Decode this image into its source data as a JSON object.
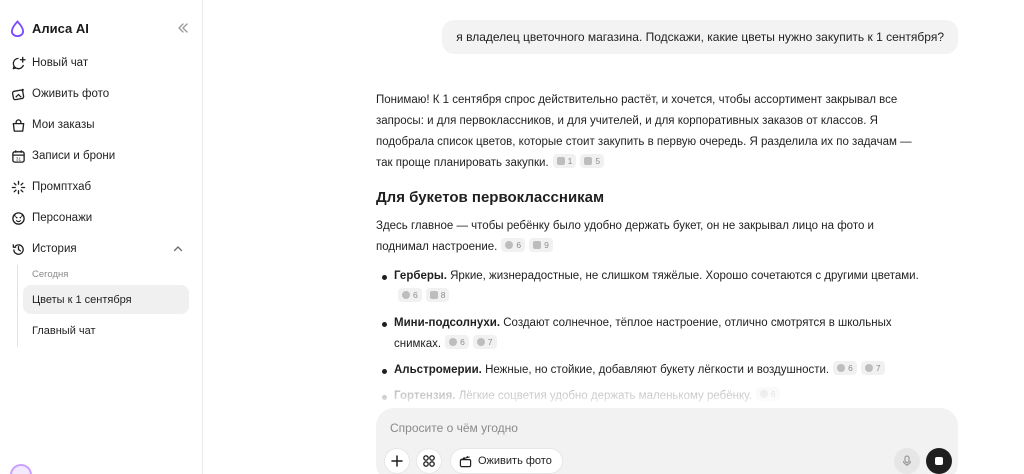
{
  "app": {
    "name": "Алиса AI",
    "brand_color": "#7b4dff"
  },
  "sidebar": {
    "nav": [
      {
        "label": "Новый чат",
        "icon": "new-chat-icon"
      },
      {
        "label": "Оживить фото",
        "icon": "animate-photo-icon"
      },
      {
        "label": "Мои заказы",
        "icon": "shopping-bag-icon"
      },
      {
        "label": "Записи и брони",
        "icon": "calendar-icon"
      },
      {
        "label": "Промптхаб",
        "icon": "sparkle-icon"
      },
      {
        "label": "Персонажи",
        "icon": "characters-icon"
      },
      {
        "label": "История",
        "icon": "history-icon"
      }
    ],
    "history_section": "Сегодня",
    "history": [
      {
        "label": "Цветы к 1 сентября",
        "active": true
      },
      {
        "label": "Главный чат",
        "active": false
      }
    ]
  },
  "chat": {
    "user_message": "я владелец цветочного магазина. Подскажи, какие цветы нужно закупить к 1 сентября?",
    "intro": "Понимаю! К 1 сентября спрос действительно растёт, и хочется, чтобы ассортимент закрывал все запросы: и для первоклассников, и для учителей, и для корпоративных заказов от классов. Я подобрала список цветов, которые стоит закупить в первую очередь. Я разделила их по задачам — так проще планировать закупки.",
    "intro_sources": [
      "1",
      "5"
    ],
    "heading": "Для букетов первоклассникам",
    "para": "Здесь главное — чтобы ребёнку было удобно держать букет, он не закрывал лицо на фото и поднимал настроение.",
    "para_sources": [
      "6",
      "9"
    ],
    "items": [
      {
        "title": "Герберы.",
        "text": "Яркие, жизнерадостные, не слишком тяжёлые. Хорошо сочетаются с другими цветами.",
        "sources": [
          "6",
          "8"
        ]
      },
      {
        "title": "Мини-подсолнухи.",
        "text": "Создают солнечное, тёплое настроение, отлично смотрятся в школьных снимках.",
        "sources": [
          "6",
          "7"
        ]
      },
      {
        "title": "Альстромерии.",
        "text": "Нежные, но стойкие, добавляют букету лёгкости и воздушности.",
        "sources": [
          "6",
          "7"
        ]
      },
      {
        "title": "Гортензия.",
        "text": "Лёгкие соцветия удобно держать маленькому ребёнку.",
        "sources": [
          "6"
        ]
      }
    ]
  },
  "composer": {
    "placeholder": "Спросите о чём угодно",
    "animate_label": "Оживить фото"
  }
}
